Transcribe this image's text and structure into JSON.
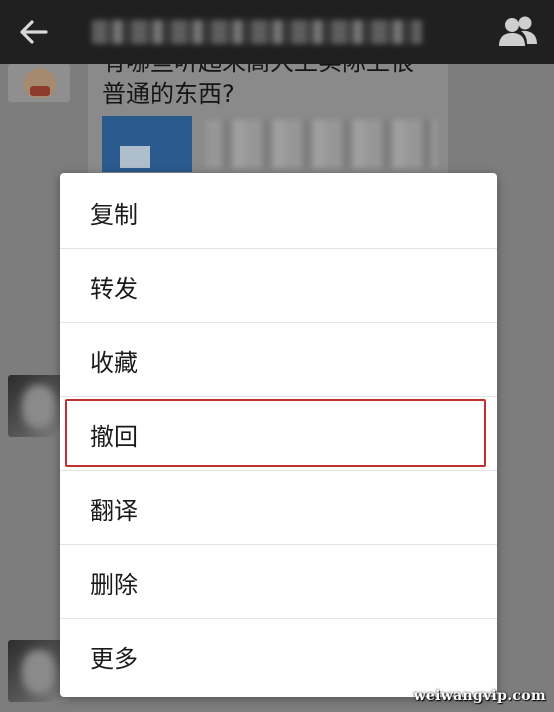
{
  "header": {
    "back_icon": "arrow-left-icon",
    "contacts_icon": "group-contacts-icon"
  },
  "chat": {
    "message_line_1": "有哪些听起来高大上实际上很",
    "message_line_2": "普通的东西?"
  },
  "context_menu": {
    "items": [
      {
        "label": "复制"
      },
      {
        "label": "转发"
      },
      {
        "label": "收藏"
      },
      {
        "label": "撤回"
      },
      {
        "label": "翻译"
      },
      {
        "label": "删除"
      },
      {
        "label": "更多"
      }
    ],
    "highlighted_item": "撤回",
    "highlight_color": "#c2312f"
  },
  "watermark": "weiwangvip.com"
}
